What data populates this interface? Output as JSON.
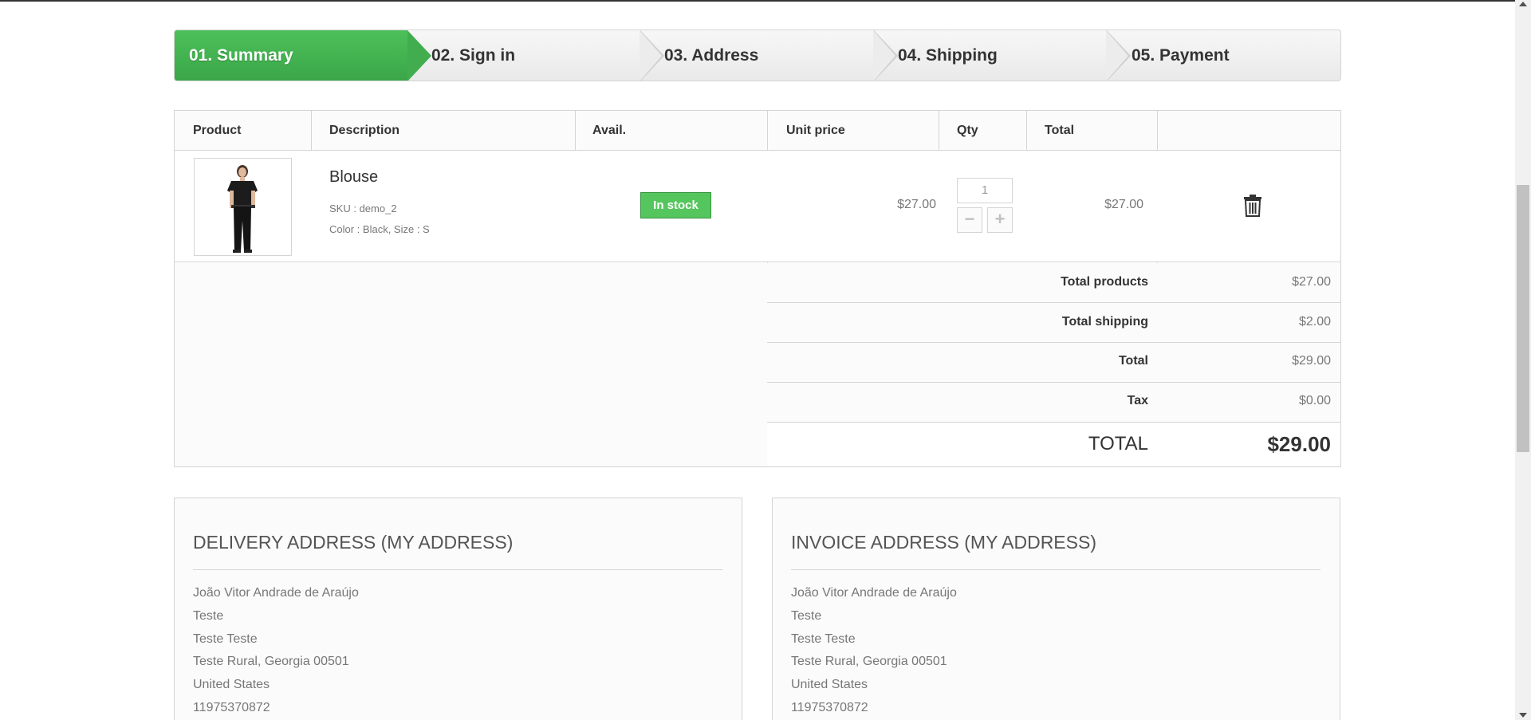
{
  "steps": [
    {
      "label": "01. Summary",
      "active": true
    },
    {
      "label": "02. Sign in",
      "active": false
    },
    {
      "label": "03. Address",
      "active": false
    },
    {
      "label": "04. Shipping",
      "active": false
    },
    {
      "label": "05. Payment",
      "active": false
    }
  ],
  "cart": {
    "headers": {
      "product": "Product",
      "description": "Description",
      "avail": "Avail.",
      "unit_price": "Unit price",
      "qty": "Qty",
      "total": "Total"
    },
    "item": {
      "name": "Blouse",
      "sku": "SKU : demo_2",
      "attributes": "Color : Black, Size : S",
      "availability": "In stock",
      "unit_price": "$27.00",
      "qty": "1",
      "total": "$27.00",
      "image_icon": "product-photo",
      "delete_icon": "trash-icon"
    },
    "totals": {
      "total_products_label": "Total products",
      "total_products_value": "$27.00",
      "total_shipping_label": "Total shipping",
      "total_shipping_value": "$2.00",
      "total_label": "Total",
      "total_value": "$29.00",
      "tax_label": "Tax",
      "tax_value": "$0.00",
      "grand_label": "TOTAL",
      "grand_value": "$29.00"
    }
  },
  "delivery": {
    "title": "DELIVERY ADDRESS (MY ADDRESS)",
    "lines": [
      "João Vitor Andrade de Araújo",
      "Teste",
      "Teste Teste",
      "Teste Rural, Georgia 00501",
      "United States",
      "11975370872"
    ]
  },
  "invoice": {
    "title": "INVOICE ADDRESS (MY ADDRESS)",
    "lines": [
      "João Vitor Andrade de Araújo",
      "Teste",
      "Teste Teste",
      "Teste Rural, Georgia 00501",
      "United States",
      "11975370872"
    ]
  },
  "colors": {
    "accent_green": "#46b552",
    "stock_green": "#55c65e",
    "border": "#d6d4d4"
  }
}
